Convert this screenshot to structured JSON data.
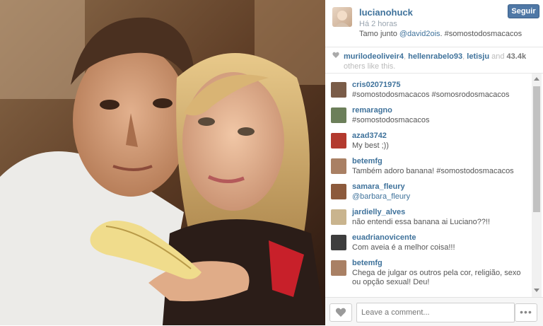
{
  "post": {
    "username": "lucianohuck",
    "time": "Há 2 horas",
    "caption_prefix": "Tamo junto ",
    "caption_mention": "@david2ois",
    "caption_suffix": ". #somostodosmacacos",
    "follow_label": "Seguir"
  },
  "likes": {
    "likers": [
      "murilodeoliveir4",
      "hellenrabelo93",
      "letisju"
    ],
    "and_text": " and ",
    "count": "43.4k",
    "suffix": " others like this."
  },
  "comments": [
    {
      "user": "cris02071975",
      "text": "#somostodosmacacos #somosrodosmacacos",
      "mention": false,
      "avatar_color": "#7a5c48"
    },
    {
      "user": "remaragno",
      "text": "#somostodosmacacos",
      "mention": false,
      "avatar_color": "#6c7f5a"
    },
    {
      "user": "azad3742",
      "text": "My best ;))",
      "mention": false,
      "avatar_color": "#b33a2e"
    },
    {
      "user": "betemfg",
      "text": "Também adoro banana! #somostodosmacacos",
      "mention": false,
      "avatar_color": "#a98064"
    },
    {
      "user": "samara_fleury",
      "text": "@barbara_fleury",
      "mention": true,
      "avatar_color": "#8c5a3c"
    },
    {
      "user": "jardielly_alves",
      "text": "não entendi essa banana ai Luciano??!!",
      "mention": false,
      "avatar_color": "#c9b48e"
    },
    {
      "user": "euadrianovicente",
      "text": "Com aveia é a melhor coisa!!!",
      "mention": false,
      "avatar_color": "#3d3d3d"
    },
    {
      "user": "betemfg",
      "text": "Chega de julgar os outros pela cor, religião, sexo ou opção sexual! Deu!",
      "mention": false,
      "avatar_color": "#a98064"
    }
  ],
  "footer": {
    "comment_placeholder": "Leave a comment...",
    "more_label": "•••"
  },
  "colors": {
    "link": "#3f729b",
    "follow_button": "#4f78a6"
  },
  "icons": [
    "heart-icon",
    "chevron-up-icon",
    "chevron-down-icon",
    "more-icon"
  ]
}
